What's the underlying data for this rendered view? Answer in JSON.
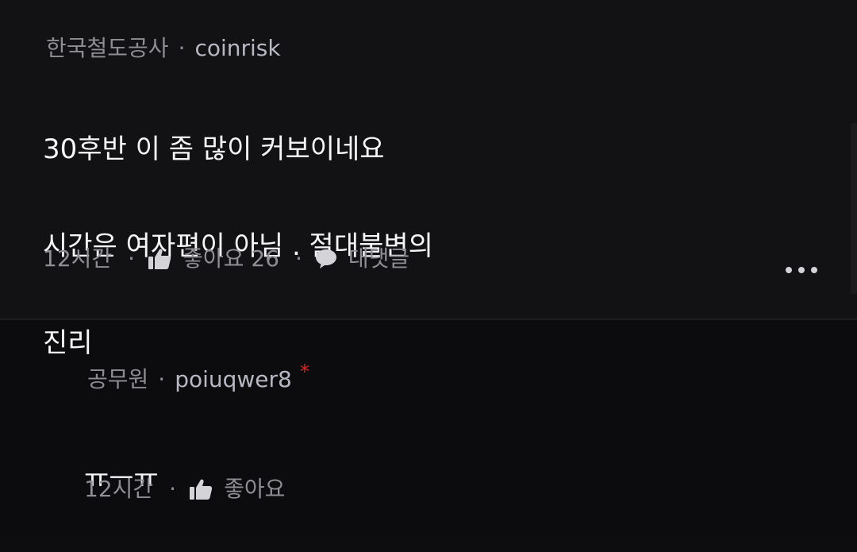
{
  "comment": {
    "affiliation": "한국철도공사",
    "separator": "·",
    "nickname": "coinrisk",
    "lines": [
      "30후반 이 좀 많이 커보이네요",
      "시간은 여자편이 아님 . 절대불변의",
      "진리"
    ],
    "time": "12시간",
    "like_label": "좋아요",
    "like_count": "26",
    "reply_label": "대댓글",
    "icons": {
      "like": "thumbs-up-icon",
      "reply": "speech-bubble-icon",
      "more": "more-dots-icon"
    }
  },
  "reply": {
    "affiliation": "공무원",
    "separator": "·",
    "nickname": "poiuqwer8",
    "author_mark": "*",
    "text": "ㅠㅡㅠ",
    "time": "12시간",
    "like_label": "좋아요"
  },
  "colors": {
    "background": "#121214",
    "reply_background": "#0c0c0e",
    "meta_text": "#8e8e93",
    "body_text": "#f5f5f7",
    "author_mark": "#e0231f"
  }
}
